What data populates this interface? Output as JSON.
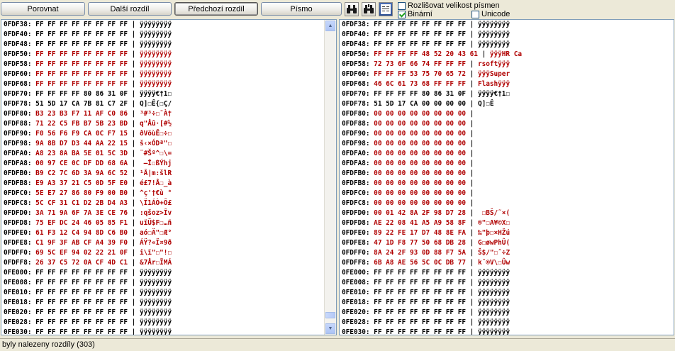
{
  "toolbar": {
    "compare": "Porovnat",
    "next_diff": "Další rozdíl",
    "prev_diff": "Předchozí rozdíl",
    "font": "Písmo",
    "case_sensitive": "Rozlišovat velikost písmen",
    "binary": "Binární",
    "unicode": "Unicode",
    "case_checked": false,
    "binary_checked": true,
    "unicode_checked": false
  },
  "left_rows": [
    {
      "addr": "0FDF38:",
      "hex": "FF FF FF FF FF FF FF FF",
      "ascii": "ÿÿÿÿÿÿÿÿ",
      "diff": false
    },
    {
      "addr": "0FDF40:",
      "hex": "FF FF FF FF FF FF FF FF",
      "ascii": "ÿÿÿÿÿÿÿÿ",
      "diff": false
    },
    {
      "addr": "0FDF48:",
      "hex": "FF FF FF FF FF FF FF FF",
      "ascii": "ÿÿÿÿÿÿÿÿ",
      "diff": false
    },
    {
      "addr": "0FDF50:",
      "hex": "FF FF FF FF FF FF FF FF",
      "ascii": "ÿÿÿÿÿÿÿÿ",
      "diff": true
    },
    {
      "addr": "0FDF58:",
      "hex": "FF FF FF FF FF FF FF FF",
      "ascii": "ÿÿÿÿÿÿÿÿ",
      "diff": true
    },
    {
      "addr": "0FDF60:",
      "hex": "FF FF FF FF FF FF FF FF",
      "ascii": "ÿÿÿÿÿÿÿÿ",
      "diff": true
    },
    {
      "addr": "0FDF68:",
      "hex": "FF FF FF FF FF FF FF FF",
      "ascii": "ÿÿÿÿÿÿÿÿ",
      "diff": true
    },
    {
      "addr": "0FDF70:",
      "hex": "FF FF FF FF 80 86 31 0F",
      "ascii": "ÿÿÿÿ€†1☐",
      "diff": false
    },
    {
      "addr": "0FDF78:",
      "hex": "51 5D 17 CA 7B 81 C7 2F",
      "ascii": "Q]☐Ê{☐Ç/",
      "diff": false
    },
    {
      "addr": "0FDF80:",
      "hex": "B3 23 B3 F7 11 AF C0 86",
      "ascii": "³#³÷☐¯À†",
      "diff": true
    },
    {
      "addr": "0FDF88:",
      "hex": "71 22 C5 FB B7 5B 23 BD",
      "ascii": "q\"Åû·[#½",
      "diff": true
    },
    {
      "addr": "0FDF90:",
      "hex": "F0 56 F6 F9 CA 0C F7 15",
      "ascii": "ðVöùÊ☐÷☐",
      "diff": true
    },
    {
      "addr": "0FDF98:",
      "hex": "9A 8B D7 D3 44 AA 22 15",
      "ascii": "š‹×ÓDª\"☐",
      "diff": true
    },
    {
      "addr": "0FDFA0:",
      "hex": "A8 23 8A BA 5E 01 5C 3D",
      "ascii": "¨#Šº^☐\\=",
      "diff": true
    },
    {
      "addr": "0FDFA8:",
      "hex": "00 97 CE 0C DF DD 68 6A",
      "ascii": " —Î☐ßÝhj",
      "diff": true
    },
    {
      "addr": "0FDFB0:",
      "hex": "B9 C2 7C 6D 3A 9A 6C 52",
      "ascii": "¹Â|m:šlR",
      "diff": true
    },
    {
      "addr": "0FDFB8:",
      "hex": "E9 A3 37 21 C5 0D 5F E0",
      "ascii": "é£7!Å☐_à",
      "diff": true
    },
    {
      "addr": "0FDFC0:",
      "hex": "5E E7 27 86 80 F9 00 B0",
      "ascii": "^ç'†€ù °",
      "diff": true
    },
    {
      "addr": "0FDFC8:",
      "hex": "5C CF 31 C1 D2 2B D4 A3",
      "ascii": "\\Ï1ÁÒ+Ô£",
      "diff": true
    },
    {
      "addr": "0FDFD0:",
      "hex": "3A 71 9A 6F 7A 3E CE 76",
      "ascii": ":qšoz>Îv",
      "diff": true
    },
    {
      "addr": "0FDFD8:",
      "hex": "75 EF DC 24 46 05 85 F1",
      "ascii": "uïÜ$F☐…ñ",
      "diff": true
    },
    {
      "addr": "0FDFE0:",
      "hex": "61 F3 12 C4 94 8D C6 B0",
      "ascii": "aó☐Ä\"☐Æ°",
      "diff": true
    },
    {
      "addr": "0FDFE8:",
      "hex": "C1 9F 3F AB CF A4 39 F0",
      "ascii": "ÁŸ?«Ï¤9ð",
      "diff": true
    },
    {
      "addr": "0FDFF0:",
      "hex": "69 5C EF 94 02 22 21 0F",
      "ascii": "i\\ï\"☐\"!☐",
      "diff": true
    },
    {
      "addr": "0FDFF8:",
      "hex": "26 37 C5 72 0A CF 4D C1",
      "ascii": "&7År☐ÏMÁ",
      "diff": true
    },
    {
      "addr": "0FE000:",
      "hex": "FF FF FF FF FF FF FF FF",
      "ascii": "ÿÿÿÿÿÿÿÿ",
      "diff": false
    },
    {
      "addr": "0FE008:",
      "hex": "FF FF FF FF FF FF FF FF",
      "ascii": "ÿÿÿÿÿÿÿÿ",
      "diff": false
    },
    {
      "addr": "0FE010:",
      "hex": "FF FF FF FF FF FF FF FF",
      "ascii": "ÿÿÿÿÿÿÿÿ",
      "diff": false
    },
    {
      "addr": "0FE018:",
      "hex": "FF FF FF FF FF FF FF FF",
      "ascii": "ÿÿÿÿÿÿÿÿ",
      "diff": false
    },
    {
      "addr": "0FE020:",
      "hex": "FF FF FF FF FF FF FF FF",
      "ascii": "ÿÿÿÿÿÿÿÿ",
      "diff": false
    },
    {
      "addr": "0FE028:",
      "hex": "FF FF FF FF FF FF FF FF",
      "ascii": "ÿÿÿÿÿÿÿÿ",
      "diff": false
    },
    {
      "addr": "0FE030:",
      "hex": "FF FF FF FF FF FF FF FF",
      "ascii": "ÿÿÿÿÿÿÿÿ",
      "diff": false
    }
  ],
  "right_rows": [
    {
      "addr": "0FDF38:",
      "hex": "FF FF FF FF FF FF FF FF",
      "ascii": "ÿÿÿÿÿÿÿÿ",
      "diff": false
    },
    {
      "addr": "0FDF40:",
      "hex": "FF FF FF FF FF FF FF FF",
      "ascii": "ÿÿÿÿÿÿÿÿ",
      "diff": false
    },
    {
      "addr": "0FDF48:",
      "hex": "FF FF FF FF FF FF FF FF",
      "ascii": "ÿÿÿÿÿÿÿÿ",
      "diff": false
    },
    {
      "addr": "0FDF50:",
      "hex": "FF FF FF FF 48 52 20 43 61",
      "ascii": "ÿÿÿHR Ca",
      "diff": true
    },
    {
      "addr": "0FDF58:",
      "hex": "72 73 6F 66 74 FF FF FF",
      "ascii": "rsoftÿÿÿ",
      "diff": true
    },
    {
      "addr": "0FDF60:",
      "hex": "FF FF FF 53 75 70 65 72",
      "ascii": "ÿÿÿSuper",
      "diff": true
    },
    {
      "addr": "0FDF68:",
      "hex": "46 6C 61 73 68 FF FF FF",
      "ascii": "Flashÿÿÿ",
      "diff": true
    },
    {
      "addr": "0FDF70:",
      "hex": "FF FF FF FF 80 86 31 0F",
      "ascii": "ÿÿÿÿ€†1☐",
      "diff": false
    },
    {
      "addr": "0FDF78:",
      "hex": "51 5D 17 CA 00 00 00 00",
      "ascii": "Q]☐Ê",
      "diff": false
    },
    {
      "addr": "0FDF80:",
      "hex": "00 00 00 00 00 00 00 00",
      "ascii": "",
      "diff": true
    },
    {
      "addr": "0FDF88:",
      "hex": "00 00 00 00 00 00 00 00",
      "ascii": "",
      "diff": true
    },
    {
      "addr": "0FDF90:",
      "hex": "00 00 00 00 00 00 00 00",
      "ascii": "",
      "diff": true
    },
    {
      "addr": "0FDF98:",
      "hex": "00 00 00 00 00 00 00 00",
      "ascii": "",
      "diff": true
    },
    {
      "addr": "0FDFA0:",
      "hex": "00 00 00 00 00 00 00 00",
      "ascii": "",
      "diff": true
    },
    {
      "addr": "0FDFA8:",
      "hex": "00 00 00 00 00 00 00 00",
      "ascii": "",
      "diff": true
    },
    {
      "addr": "0FDFB0:",
      "hex": "00 00 00 00 00 00 00 00",
      "ascii": "",
      "diff": true
    },
    {
      "addr": "0FDFB8:",
      "hex": "00 00 00 00 00 00 00 00",
      "ascii": "",
      "diff": true
    },
    {
      "addr": "0FDFC0:",
      "hex": "00 00 00 00 00 00 00 00",
      "ascii": "",
      "diff": true
    },
    {
      "addr": "0FDFC8:",
      "hex": "00 00 00 00 00 00 00 00",
      "ascii": "",
      "diff": true
    },
    {
      "addr": "0FDFD0:",
      "hex": "00 01 42 8A 2F 98 D7 28",
      "ascii": " ☐BŠ/˜×(",
      "diff": true
    },
    {
      "addr": "0FDFD8:",
      "hex": "AE 22 08 41 A5 A9 58 8F",
      "ascii": "®\"☐A¥©X☐",
      "diff": true
    },
    {
      "addr": "0FDFE0:",
      "hex": "89 22 FE 17 D7 48 8E FA",
      "ascii": "‰\"þ☐×HŽú",
      "diff": true
    },
    {
      "addr": "0FDFE8:",
      "hex": "47 1D F8 77 50 68 DB 28",
      "ascii": "G☐øwPhÛ(",
      "diff": true
    },
    {
      "addr": "0FDFF0:",
      "hex": "8A 24 2F 93 0D 88 F7 5A",
      "ascii": "Š$/\"☐ˆ÷Z",
      "diff": true
    },
    {
      "addr": "0FDFF8:",
      "hex": "6B A8 AE 56 5C 0C DB 77",
      "ascii": "k¨®V\\☐Ûw",
      "diff": true
    },
    {
      "addr": "0FE000:",
      "hex": "FF FF FF FF FF FF FF FF",
      "ascii": "ÿÿÿÿÿÿÿÿ",
      "diff": false
    },
    {
      "addr": "0FE008:",
      "hex": "FF FF FF FF FF FF FF FF",
      "ascii": "ÿÿÿÿÿÿÿÿ",
      "diff": false
    },
    {
      "addr": "0FE010:",
      "hex": "FF FF FF FF FF FF FF FF",
      "ascii": "ÿÿÿÿÿÿÿÿ",
      "diff": false
    },
    {
      "addr": "0FE018:",
      "hex": "FF FF FF FF FF FF FF FF",
      "ascii": "ÿÿÿÿÿÿÿÿ",
      "diff": false
    },
    {
      "addr": "0FE020:",
      "hex": "FF FF FF FF FF FF FF FF",
      "ascii": "ÿÿÿÿÿÿÿÿ",
      "diff": false
    },
    {
      "addr": "0FE028:",
      "hex": "FF FF FF FF FF FF FF FF",
      "ascii": "ÿÿÿÿÿÿÿÿ",
      "diff": false
    },
    {
      "addr": "0FE030:",
      "hex": "FF FF FF FF FF FF FF FF",
      "ascii": "ÿÿÿÿÿÿÿÿ",
      "diff": false
    }
  ],
  "status": "byly nalezeny rozdíly (303)",
  "colors": {
    "diff_text": "#b00000",
    "normal_text": "#000000",
    "window_bg": "#ece9d8"
  },
  "icons": [
    "binoculars-find-icon",
    "binoculars-find-next-icon",
    "hex-view-icon"
  ]
}
